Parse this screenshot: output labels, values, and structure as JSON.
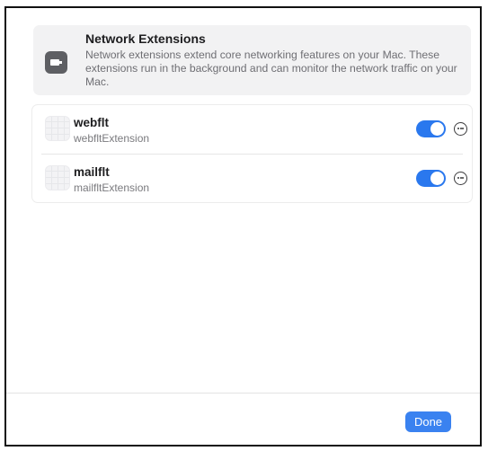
{
  "header": {
    "title": "Network Extensions",
    "description": "Network extensions extend core networking features on your Mac. These extensions run in the background and can monitor the network traffic on your Mac.",
    "icon": "network-extension-icon"
  },
  "extensions": [
    {
      "name": "webflt",
      "identifier": "webfltExtension",
      "enabled": true
    },
    {
      "name": "mailflt",
      "identifier": "mailfltExtension",
      "enabled": true
    }
  ],
  "footer": {
    "done_label": "Done"
  },
  "colors": {
    "accent": "#2a78ee",
    "button": "#3a82f0"
  }
}
